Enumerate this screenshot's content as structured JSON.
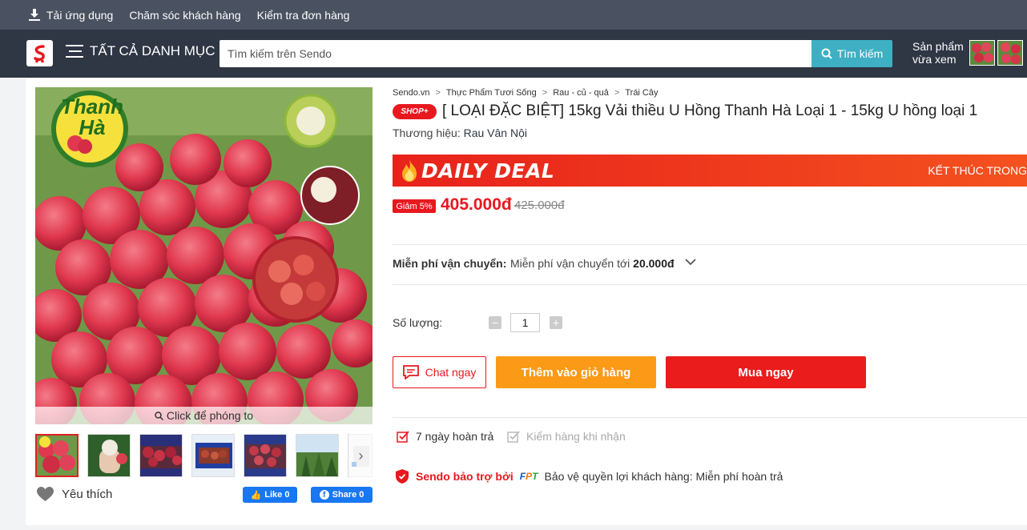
{
  "topbar": {
    "download_app": "Tải ứng dụng",
    "customer_care": "Chăm sóc khách hàng",
    "check_order": "Kiểm tra đơn hàng"
  },
  "header": {
    "all_categories": "TẤT CẢ DANH MỤC",
    "search_placeholder": "Tìm kiếm trên Sendo",
    "search_button": "Tìm kiếm",
    "recent_line1": "Sản phẩm",
    "recent_line2": "vừa xem"
  },
  "gallery": {
    "zoom_label": "Click để phóng to",
    "brand_logo_text": "Thanh Hà",
    "favorite_label": "Yêu thích",
    "fb_like": "Like 0",
    "fb_share": "Share 0"
  },
  "breadcrumb": [
    "Sendo.vn",
    "Thực Phẩm Tươi Sống",
    "Rau - củ - quả",
    "Trái Cây"
  ],
  "product": {
    "shop_badge": "SHOP+",
    "title": "[ LOẠI ĐẶC BIỆT] 15kg Vải thiều U Hồng Thanh Hà Loại 1 - 15kg U hồng loại 1",
    "brand_label": "Thương hiệu:",
    "brand_value": "Rau Vân Nội",
    "deal_title": "DAILY DEAL",
    "deal_end": "KẾT THÚC TRONG",
    "discount": "Giảm 5%",
    "price": "405.000đ",
    "old_price": "425.000đ"
  },
  "shipping": {
    "label": "Miễn phí vận chuyển:",
    "value_prefix": "Miễn phí vận chuyển tới",
    "value_amount": "20.000đ"
  },
  "quantity": {
    "label": "Số lượng:",
    "value": "1"
  },
  "actions": {
    "chat": "Chat ngay",
    "add_to_cart": "Thêm vào giỏ hàng",
    "buy_now": "Mua ngay"
  },
  "policies": {
    "return_days": "7 ngày hoàn trả",
    "inspect": "Kiểm hàng khi nhận",
    "guarantee_prefix": "Sendo bảo trợ bởi",
    "guarantee_partner": "FPT",
    "guarantee_text": "Bảo vệ quyền lợi khách hàng: Miễn phí hoàn trả"
  },
  "colors": {
    "accent_red": "#e8181e",
    "orange": "#fb9a17",
    "header_bg": "#2f3644",
    "topbar_bg": "#4a5160",
    "search_btn": "#3fb0c3"
  }
}
